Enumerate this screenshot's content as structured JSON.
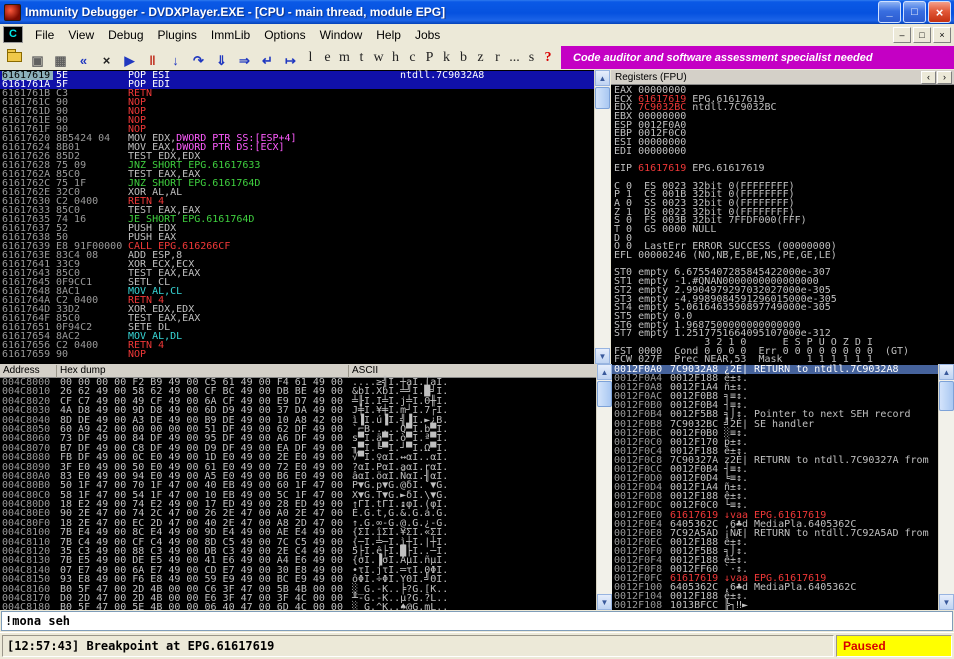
{
  "window": {
    "title": "Immunity Debugger - DVDXPlayer.EXE - [CPU - main thread, module EPG]",
    "buttons": [
      {
        "name": "minimize-button",
        "glyph": "_"
      },
      {
        "name": "restore-button",
        "glyph": "□"
      },
      {
        "name": "close-button",
        "glyph": "×"
      }
    ],
    "mdi_buttons": [
      {
        "name": "mdi-minimize-button",
        "glyph": "–"
      },
      {
        "name": "mdi-restore-button",
        "glyph": "□"
      },
      {
        "name": "mdi-close-button",
        "glyph": "×"
      }
    ]
  },
  "menu": {
    "items": [
      "File",
      "View",
      "Debug",
      "Plugins",
      "ImmLib",
      "Options",
      "Window",
      "Help",
      "Jobs"
    ]
  },
  "toolbar": {
    "icons": [
      {
        "name": "open-file-icon",
        "glyph": "",
        "color": "#E8C040"
      },
      {
        "name": "attach-icon",
        "glyph": "▣",
        "color": "#606060"
      },
      {
        "name": "windows-icon",
        "glyph": "▦",
        "color": "#606060"
      },
      {
        "name": "restart-icon",
        "glyph": "«",
        "color": "#2038C0"
      },
      {
        "name": "close-program-icon",
        "glyph": "×",
        "color": "#202020"
      },
      {
        "name": "run-icon",
        "glyph": "▶",
        "color": "#2038C0"
      },
      {
        "name": "pause-icon",
        "glyph": "‖",
        "color": "#C03020"
      },
      {
        "name": "step-into-icon",
        "glyph": "↓",
        "color": "#2038C0"
      },
      {
        "name": "step-over-icon",
        "glyph": "↷",
        "color": "#2038C0"
      },
      {
        "name": "animate-into-icon",
        "glyph": "⇓",
        "color": "#2038C0"
      },
      {
        "name": "animate-over-icon",
        "glyph": "⇒",
        "color": "#2038C0"
      },
      {
        "name": "execute-till-return-icon",
        "glyph": "↵",
        "color": "#2038C0"
      },
      {
        "name": "execute-till-user-icon",
        "glyph": "↦",
        "color": "#2038C0"
      }
    ],
    "letters": [
      "l",
      "e",
      "m",
      "t",
      "w",
      "h",
      "c",
      "P",
      "k",
      "b",
      "z",
      "r",
      "...",
      "s"
    ],
    "help_label": "?",
    "banner": "Code auditor and software assessment specialist needed"
  },
  "colors": {
    "silver": "#C0C0C0",
    "addr": "#9A9A9A",
    "gray": "#8C8C8C",
    "white": "#FFFFFF",
    "red": "#F03838",
    "green": "#3FD03F",
    "cyan": "#38D8D8",
    "magenta": "#FF5CFF",
    "eip_addr_bg": "#8CB0BC",
    "disasm_sel_bg": "#1010A8",
    "stack_sel_bg": "#46639C",
    "banner_bg": "#C400C4",
    "paused_bg": "#FFFF00",
    "paused_fg": "#D80000"
  },
  "disasm": {
    "rows": [
      {
        "a": "61617619",
        "b": "5E",
        "t": "POP ESI",
        "c": "white",
        "sel": true,
        "eip": true,
        "cm": "ntdll.7C9032A8"
      },
      {
        "a": "6161761A",
        "b": "5F",
        "t": "POP EDI",
        "c": "white",
        "sel": true
      },
      {
        "a": "6161761B",
        "b": "C3",
        "t": "RETN",
        "c": "red"
      },
      {
        "a": "6161761C",
        "b": "90",
        "t": "NOP",
        "c": "red"
      },
      {
        "a": "6161761D",
        "b": "90",
        "t": "NOP",
        "c": "red"
      },
      {
        "a": "6161761E",
        "b": "90",
        "t": "NOP",
        "c": "red"
      },
      {
        "a": "6161761F",
        "b": "90",
        "t": "NOP",
        "c": "red"
      },
      {
        "a": "61617620",
        "b": "8B5424 04",
        "t": "MOV EDX,",
        "t2": "DWORD PTR SS:[ESP+4]",
        "c": "silver",
        "c2": "magenta"
      },
      {
        "a": "61617624",
        "b": "8B01",
        "t": "MOV EAX,",
        "t2": "DWORD PTR DS:[ECX]",
        "c": "silver",
        "c2": "magenta"
      },
      {
        "a": "61617626",
        "b": "85D2",
        "t": "TEST EDX,EDX",
        "c": "silver"
      },
      {
        "a": "61617628",
        "b": "75 09",
        "t": "JNZ SHORT EPG.61617633",
        "c": "green"
      },
      {
        "a": "6161762A",
        "b": "85C0",
        "t": "TEST EAX,EAX",
        "c": "silver"
      },
      {
        "a": "6161762C",
        "b": "75 1F",
        "t": "JNZ SHORT EPG.6161764D",
        "c": "green"
      },
      {
        "a": "6161762E",
        "b": "32C0",
        "t": "XOR AL,AL",
        "c": "silver"
      },
      {
        "a": "61617630",
        "b": "C2 0400",
        "t": "RETN 4",
        "c": "red"
      },
      {
        "a": "61617633",
        "b": "85C0",
        "t": "TEST EAX,EAX",
        "c": "silver"
      },
      {
        "a": "61617635",
        "b": "74 16",
        "t": "JE SHORT EPG.6161764D",
        "c": "green"
      },
      {
        "a": "61617637",
        "b": "52",
        "t": "PUSH EDX",
        "c": "silver"
      },
      {
        "a": "61617638",
        "b": "50",
        "t": "PUSH EAX",
        "c": "silver"
      },
      {
        "a": "61617639",
        "b": "E8 91F00000",
        "t": "CALL EPG.616266CF",
        "c": "red"
      },
      {
        "a": "6161763E",
        "b": "83C4 08",
        "t": "ADD ESP,8",
        "c": "silver"
      },
      {
        "a": "61617641",
        "b": "33C9",
        "t": "XOR ECX,ECX",
        "c": "silver"
      },
      {
        "a": "61617643",
        "b": "85C0",
        "t": "TEST EAX,EAX",
        "c": "silver"
      },
      {
        "a": "61617645",
        "b": "0F9CC1",
        "t": "SETL CL",
        "c": "silver"
      },
      {
        "a": "61617648",
        "b": "8AC1",
        "t": "MOV AL,CL",
        "c": "cyan"
      },
      {
        "a": "6161764A",
        "b": "C2 0400",
        "t": "RETN 4",
        "c": "red"
      },
      {
        "a": "6161764D",
        "b": "33D2",
        "t": "XOR EDX,EDX",
        "c": "silver"
      },
      {
        "a": "6161764F",
        "b": "85C0",
        "t": "TEST EAX,EAX",
        "c": "silver"
      },
      {
        "a": "61617651",
        "b": "0F94C2",
        "t": "SETE DL",
        "c": "silver"
      },
      {
        "a": "61617654",
        "b": "8AC2",
        "t": "MOV AL,DL",
        "c": "cyan"
      },
      {
        "a": "61617656",
        "b": "C2 0400",
        "t": "RETN 4",
        "c": "red"
      },
      {
        "a": "61617659",
        "b": "90",
        "t": "NOP",
        "c": "red"
      }
    ]
  },
  "registers": {
    "title": "Registers (FPU)",
    "lines": [
      [
        [
          "EAX ",
          "silver"
        ],
        [
          "00000000",
          "silver"
        ]
      ],
      [
        [
          "ECX ",
          "silver"
        ],
        [
          "61617619",
          "red"
        ],
        [
          " EPG.61617619",
          "silver"
        ]
      ],
      [
        [
          "EDX ",
          "silver"
        ],
        [
          "7C9032BC",
          "red"
        ],
        [
          " ntdll.7C9032BC",
          "silver"
        ]
      ],
      [
        [
          "EBX ",
          "silver"
        ],
        [
          "00000000",
          "silver"
        ]
      ],
      [
        [
          "ESP ",
          "silver"
        ],
        [
          "0012F0A0",
          "silver"
        ]
      ],
      [
        [
          "EBP ",
          "silver"
        ],
        [
          "0012F0C0",
          "silver"
        ]
      ],
      [
        [
          "ESI ",
          "silver"
        ],
        [
          "00000000",
          "silver"
        ]
      ],
      [
        [
          "EDI ",
          "silver"
        ],
        [
          "00000000",
          "silver"
        ]
      ],
      [
        [
          "",
          "silver"
        ]
      ],
      [
        [
          "EIP ",
          "silver"
        ],
        [
          "61617619",
          "red"
        ],
        [
          " EPG.61617619",
          "silver"
        ]
      ],
      [
        [
          "",
          "silver"
        ]
      ],
      [
        [
          "C 0  ES 0023 32bit 0(FFFFFFFF)",
          "silver"
        ]
      ],
      [
        [
          "P 1  CS 001B 32bit 0(FFFFFFFF)",
          "silver"
        ]
      ],
      [
        [
          "A 0  SS 0023 32bit 0(FFFFFFFF)",
          "silver"
        ]
      ],
      [
        [
          "Z 1  DS 0023 32bit 0(FFFFFFFF)",
          "silver"
        ]
      ],
      [
        [
          "S 0  FS 003B 32bit 7FFDF000(FFF)",
          "silver"
        ]
      ],
      [
        [
          "T 0  GS 0000 NULL",
          "silver"
        ]
      ],
      [
        [
          "D 0",
          "silver"
        ]
      ],
      [
        [
          "O 0  LastErr ERROR_SUCCESS (00000000)",
          "silver"
        ]
      ],
      [
        [
          "EFL 00000246 (NO,NB,E,BE,NS,PE,GE,LE)",
          "silver"
        ]
      ],
      [
        [
          "",
          "silver"
        ]
      ],
      [
        [
          "ST0 empty 6.6755407285845422000e-307",
          "silver"
        ]
      ],
      [
        [
          "ST1 empty -1.#QNAN0000000000000000",
          "silver"
        ]
      ],
      [
        [
          "ST2 empty 2.9904979297032027000e-305",
          "silver"
        ]
      ],
      [
        [
          "ST3 empty -4.9989084591296015000e-305",
          "silver"
        ]
      ],
      [
        [
          "ST4 empty 5.0616463590897749000e-305",
          "silver"
        ]
      ],
      [
        [
          "ST5 empty 0.0",
          "silver"
        ]
      ],
      [
        [
          "ST6 empty 1.9687500000000000000",
          "silver"
        ]
      ],
      [
        [
          "ST7 empty 1.2517751664095107000e-312",
          "silver"
        ]
      ],
      [
        [
          "               3 2 1 0      E S P U O Z D I",
          "silver"
        ]
      ],
      [
        [
          "FST 0000  Cond 0 0 0 0  Err 0 0 0 0 0 0 0 0  (GT)",
          "silver"
        ]
      ],
      [
        [
          "FCW 027F  Prec NEAR,53  Mask    1 1 1 1 1 1",
          "silver"
        ]
      ]
    ]
  },
  "dump": {
    "headers": [
      "Address",
      "Hex dump",
      "ASCII"
    ],
    "rows": [
      {
        "a": "004C8000",
        "h": "00 00 00 00 F2 B9 49 00 C5 61 49 00 F4 61 49 00",
        "s": "....≥╣I.┼aI.⌠aI."
      },
      {
        "a": "004C8010",
        "h": "26 62 49 00 58 62 49 00 CF BC 49 00 DB BE 49 00",
        "s": "&bI.XbI.╧╝I.█╛I."
      },
      {
        "a": "004C8020",
        "h": "CF C7 49 00 49 CF 49 00 6A CF 49 00 E9 D7 49 00",
        "s": "╧╟I.I╧I.j╧I.Θ╫I."
      },
      {
        "a": "004C8030",
        "h": "4A D8 49 00 9D D8 49 00 6D D9 49 00 37 DA 49 00",
        "s": "J╪I.¥╪I.m┘I.7┌I."
      },
      {
        "a": "004C8040",
        "h": "8D DE 49 00 A3 DE 49 00 B9 DE 49 00 10 A8 42 00",
        "s": "ì▐I.ú▐I.╣▐I.►¿B."
      },
      {
        "a": "004C8050",
        "h": "60 A9 42 00 00 00 00 00 51 DF 49 00 62 DF 49 00",
        "s": "`⌐B.....Q▀I.b▀I."
      },
      {
        "a": "004C8060",
        "h": "73 DF 49 00 84 DF 49 00 95 DF 49 00 A6 DF 49 00",
        "s": "s▀I.ä▀I.ò▀I.ª▀I."
      },
      {
        "a": "004C8070",
        "h": "B7 DF 49 00 C8 DF 49 00 D9 DF 49 00 EA DF 49 00",
        "s": "╖▀I.╚▀I.┘▀I.Ω▀I."
      },
      {
        "a": "004C8080",
        "h": "FB DF 49 00 0C E0 49 00 1D E0 49 00 2E E0 49 00",
        "s": "√▀I.♀αI.↔αI..αI."
      },
      {
        "a": "004C8090",
        "h": "3F E0 49 00 50 E0 49 00 61 E0 49 00 72 E0 49 00",
        "s": "?αI.PαI.aαI.rαI."
      },
      {
        "a": "004C80A0",
        "h": "83 E0 49 00 94 E0 49 00 A5 E0 49 00 B6 E0 49 00",
        "s": "âαI.öαI.ÑαI.╢αI."
      },
      {
        "a": "004C80B0",
        "h": "50 1F 47 00 70 1F 47 00 40 EB 49 00 60 1F 47 00",
        "s": "P▼G.p▼G.@δI.`▼G."
      },
      {
        "a": "004C80C0",
        "h": "58 1F 47 00 54 1F 47 00 10 EB 49 00 5C 1F 47 00",
        "s": "X▼G.T▼G.►δI.\\▼G."
      },
      {
        "a": "004C80D0",
        "h": "18 E2 49 00 74 E2 49 00 17 ED 49 00 28 ED 49 00",
        "s": "↑ΓI.tΓI.↨φI.(φI."
      },
      {
        "a": "004C80E0",
        "h": "90 2E 47 00 74 2C 47 00 26 2E 47 00 A0 2E 47 00",
        "s": "É.G.t,G.&.G.á.G."
      },
      {
        "a": "004C80F0",
        "h": "18 2E 47 00 EC 2D 47 00 40 2E 47 00 A8 2D 47 00",
        "s": "↑.G.∞-G.@.G.¿-G."
      },
      {
        "a": "004C8100",
        "h": "7B E4 49 00 8C E4 49 00 9D E4 49 00 AE E4 49 00",
        "s": "{ΣI.îΣI.¥ΣI.«ΣI."
      },
      {
        "a": "004C8110",
        "h": "7B C4 49 00 CF C4 49 00 8D C5 49 00 7C C5 49 00",
        "s": "{─I.╧─I.ì┼I.|┼I."
      },
      {
        "a": "004C8120",
        "h": "35 C3 49 00 88 C3 49 00 DB C3 49 00 2E C4 49 00",
        "s": "5├I.ê├I.█├I..─I."
      },
      {
        "a": "004C8130",
        "h": "7B E5 49 00 DE E5 49 00 41 E6 49 00 A4 E6 49 00",
        "s": "{σI.▐σI.AµI.ñµI."
      },
      {
        "a": "004C8140",
        "h": "07 E7 49 00 6A E7 49 00 CD E7 49 00 30 E8 49 00",
        "s": "•τI.jτI.═τI.0ΦI."
      },
      {
        "a": "004C8150",
        "h": "93 E8 49 00 F6 E8 49 00 59 E9 49 00 BC E9 49 00",
        "s": "ôΦI.÷ΦI.YΘI.╝ΘI."
      },
      {
        "a": "004C8160",
        "h": "B0 5F 47 00 2D 4B 00 00 C6 3F 47 00 5B 4B 00 00",
        "s": "░_G.-K..╞?G.[K.."
      },
      {
        "a": "004C8170",
        "h": "D0 2D 47 00 2D 4B 00 00 E6 3F 47 00 3F 4C 00 00",
        "s": "╨-G.-K..µ?G.?L.."
      },
      {
        "a": "004C8180",
        "h": "B0 5F 47 00 5E 4B 00 00 06 40 47 00 6D 4C 00 00",
        "s": "░_G.^K..♠@G.mL.."
      }
    ]
  },
  "stack": {
    "rows": [
      {
        "a": "0012F0A0",
        "v": "7C9032A8",
        "ch": "¿2É|",
        "cm": "RETURN to ntdll.7C9032A8",
        "sel": true
      },
      {
        "a": "0012F0A4",
        "v": "0012F188",
        "ch": "ê±↕.",
        "cm": ""
      },
      {
        "a": "0012F0A8",
        "v": "0012F1A4",
        "ch": "ñ±↕.",
        "cm": ""
      },
      {
        "a": "0012F0AC",
        "v": "0012F0B8",
        "ch": "╕≡↕.",
        "cm": ""
      },
      {
        "a": "0012F0B0",
        "v": "0012F0B4",
        "ch": "┤≡↕.",
        "cm": ""
      },
      {
        "a": "0012F0B4",
        "v": "0012F5B8",
        "ch": "╕⌡↕.",
        "cm": "Pointer to next SEH record"
      },
      {
        "a": "0012F0B8",
        "v": "7C9032BC",
        "ch": "╝2É|",
        "cm": "SE handler"
      },
      {
        "a": "0012F0BC",
        "v": "0012F0B0",
        "ch": "░≡↕.",
        "cm": ""
      },
      {
        "a": "0012F0C0",
        "v": "0012F170",
        "ch": "p±↕.",
        "cm": ""
      },
      {
        "a": "0012F0C4",
        "v": "0012F188",
        "ch": "ê±↕.",
        "cm": ""
      },
      {
        "a": "0012F0C8",
        "v": "7C90327A",
        "ch": "z2É|",
        "cm": "RETURN to ntdll.7C90327A from"
      },
      {
        "a": "0012F0CC",
        "v": "0012F0B4",
        "ch": "┤≡↕.",
        "cm": ""
      },
      {
        "a": "0012F0D0",
        "v": "0012F0D4",
        "ch": "╘≡↕.",
        "cm": ""
      },
      {
        "a": "0012F0D4",
        "v": "0012F1A4",
        "ch": "ñ±↕.",
        "cm": ""
      },
      {
        "a": "0012F0D8",
        "v": "0012F188",
        "ch": "ê±↕.",
        "cm": ""
      },
      {
        "a": "0012F0DC",
        "v": "0012F0C0",
        "ch": "└≡↕.",
        "cm": ""
      },
      {
        "a": "0012F0E0",
        "v": "61617619",
        "ch": "↓vaa",
        "cm": "EPG.61617619",
        "hl": "red"
      },
      {
        "a": "0012F0E4",
        "v": "6405362C",
        "ch": ",6♣d",
        "cm": "MediaPla.6405362C"
      },
      {
        "a": "0012F0E8",
        "v": "7C92A5AD",
        "ch": "¡ÑÆ|",
        "cm": "RETURN to ntdll.7C92A5AD from"
      },
      {
        "a": "0012F0EC",
        "v": "0012F188",
        "ch": "ê±↕.",
        "cm": ""
      },
      {
        "a": "0012F0F0",
        "v": "0012F5B8",
        "ch": "╕⌡↕.",
        "cm": ""
      },
      {
        "a": "0012F0F4",
        "v": "0012F188",
        "ch": "ê±↕.",
        "cm": ""
      },
      {
        "a": "0012F0F8",
        "v": "0012FF60",
        "ch": "`·↕.",
        "cm": ""
      },
      {
        "a": "0012F0FC",
        "v": "61617619",
        "ch": "↓vaa",
        "cm": "EPG.61617619",
        "hl": "red"
      },
      {
        "a": "0012F100",
        "v": "6405362C",
        "ch": ",6♣d",
        "cm": "MediaPla.6405362C"
      },
      {
        "a": "0012F104",
        "v": "0012F188",
        "ch": "ê±↕.",
        "cm": ""
      },
      {
        "a": "0012F108",
        "v": "1013BFCC",
        "ch": "╠┐‼►",
        "cm": ""
      }
    ]
  },
  "command": {
    "value": "!mona seh"
  },
  "status": {
    "left": "[12:57:43] Breakpoint at EPG.61617619",
    "right": "Paused"
  }
}
